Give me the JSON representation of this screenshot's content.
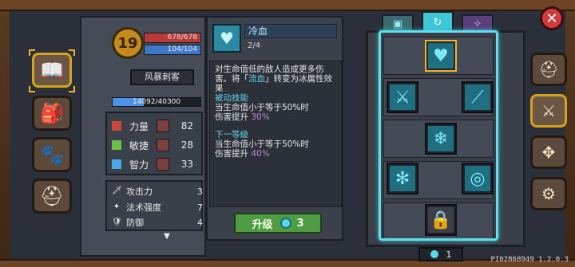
{
  "left_nav": {
    "items": [
      {
        "icon": "book-icon",
        "glyph": "📖",
        "selected": true
      },
      {
        "icon": "backpack-icon",
        "glyph": "🎒",
        "selected": false
      },
      {
        "icon": "pet-paw-icon",
        "glyph": "🐾",
        "selected": false
      },
      {
        "icon": "helmet-icon",
        "glyph": "⛑",
        "selected": false
      }
    ]
  },
  "character": {
    "level": "19",
    "hp": "678/678",
    "mp": "104/104",
    "class_name": "风暴刺客",
    "exp_text": "14092/40300",
    "exp_fraction": 0.35
  },
  "attributes": [
    {
      "label": "力量",
      "value": "82",
      "icon": "strength-icon",
      "color": "#c94a3a"
    },
    {
      "label": "敏捷",
      "value": "28",
      "icon": "agility-icon",
      "color": "#6cc04a"
    },
    {
      "label": "智力",
      "value": "33",
      "icon": "intellect-icon",
      "color": "#4aa6e6"
    }
  ],
  "combat_stats": [
    {
      "label": "攻击力",
      "value": "3",
      "icon": "sword-icon",
      "glyph": "🗡"
    },
    {
      "label": "法术强度",
      "value": "7",
      "icon": "wand-icon",
      "glyph": "✦"
    },
    {
      "label": "防御",
      "value": "4",
      "icon": "shield-icon",
      "glyph": "🛡"
    }
  ],
  "skill": {
    "name": "冷血",
    "level": "2/4",
    "desc_part1": "对生命值低的敌人造成更多伤害。将「",
    "desc_highlight": "流血",
    "desc_part2": "」转变为冰属性效果",
    "passive_title": "被动技能",
    "passive_line1": "当生命值小于等于50%时",
    "passive_line2_prefix": "伤害提升",
    "passive_line2_value": "30%",
    "next_title": "下一等级",
    "next_line1": "当生命值小于等于50%时",
    "next_line2_prefix": "伤害提升",
    "next_line2_value": "40%"
  },
  "upgrade": {
    "label": "升级",
    "cost": "3"
  },
  "tabs": [
    {
      "icon": "tab-skill-tree-1-icon",
      "glyph": "▣",
      "active": false
    },
    {
      "icon": "tab-skill-tree-2-icon",
      "glyph": "↻",
      "active": true
    },
    {
      "icon": "tab-skill-tree-3-icon",
      "glyph": "✧",
      "active": false
    }
  ],
  "tree_nodes": [
    {
      "icon": "cold-blood-heart-icon",
      "glyph": "♥",
      "selected": true
    },
    {
      "icon": "ice-slash-icon",
      "glyph": "⚔",
      "selected": false
    },
    {
      "icon": "ice-blade-icon",
      "glyph": "⟋",
      "selected": false
    },
    {
      "icon": "ice-boot-icon",
      "glyph": "❄",
      "selected": false
    },
    {
      "icon": "snowflake-icon",
      "glyph": "✻",
      "selected": false
    },
    {
      "icon": "ice-vortex-icon",
      "glyph": "◎",
      "selected": false
    },
    {
      "icon": "locked-icon",
      "glyph": "🔒",
      "selected": false
    }
  ],
  "skill_points": "1",
  "right_nav": [
    {
      "icon": "helmet-face-icon",
      "glyph": "⛑"
    },
    {
      "icon": "crossed-swords-icon",
      "glyph": "⚔"
    },
    {
      "icon": "compass-icon",
      "glyph": "✥"
    },
    {
      "icon": "settings-gear-icon",
      "glyph": "⚙"
    }
  ],
  "build_id": "PI02868949 1.2.0.3"
}
